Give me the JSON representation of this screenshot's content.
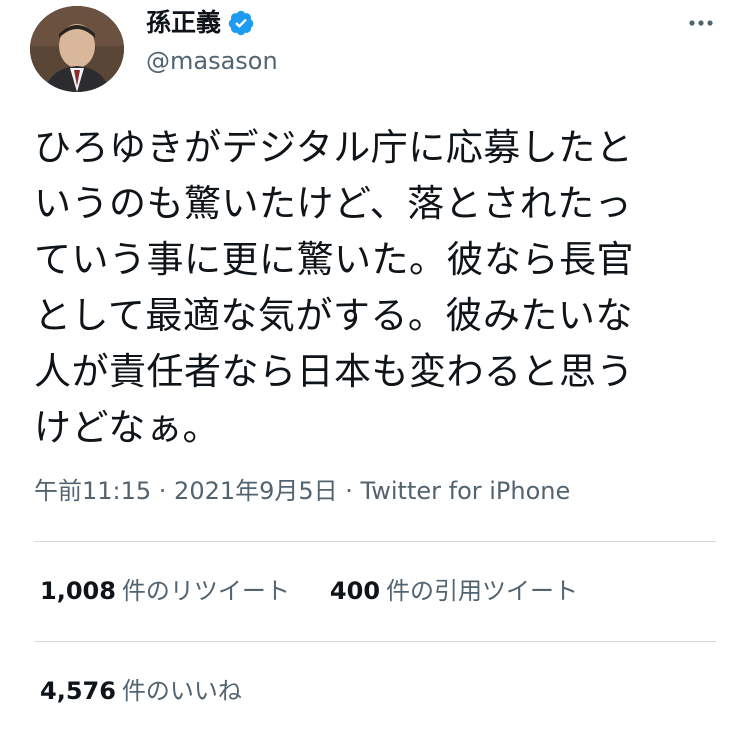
{
  "user": {
    "display_name": "孫正義",
    "handle": "@masason"
  },
  "tweet": {
    "text": "ひろゆきがデジタル庁に応募したと\nいうのも驚いたけど、落とされたっ\nていう事に更に驚いた。彼なら長官\nとして最適な気がする。彼みたいな\n人が責任者なら日本も変わると思う\nけどなぁ。",
    "timestamp": "午前11:15 · 2021年9月5日 · Twitter for iPhone"
  },
  "stats": {
    "retweets_count": "1,008",
    "retweets_label": "件のリツイート",
    "quotes_count": "400",
    "quotes_label": "件の引用ツイート",
    "likes_count": "4,576",
    "likes_label": "件のいいね"
  },
  "colors": {
    "text": "#0f1419",
    "secondary": "#536471",
    "verified": "#1d9bf0",
    "divider": "#cfd9de"
  },
  "icons": {
    "verified": "verified-badge-icon",
    "more": "more-horizontal-icon"
  }
}
